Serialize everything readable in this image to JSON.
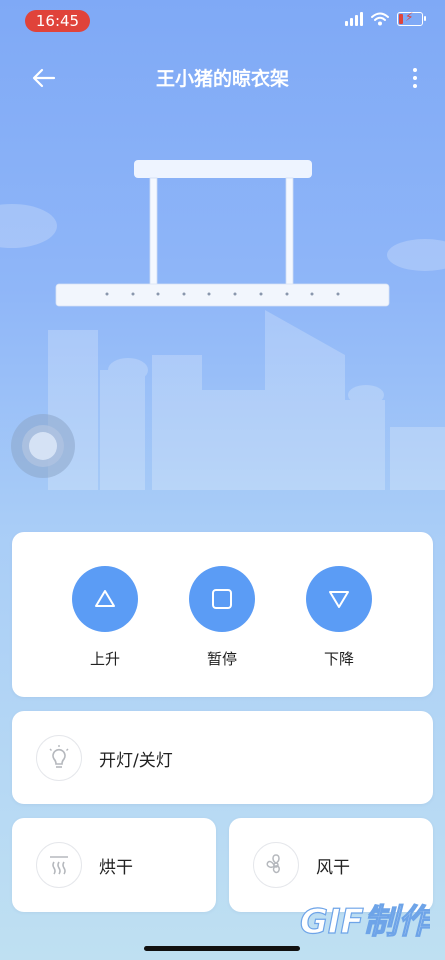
{
  "status_bar": {
    "time": "16:45"
  },
  "header": {
    "title": "王小猪的晾衣架"
  },
  "controls": [
    {
      "id": "up",
      "label": "上升",
      "icon": "triangle-up-icon"
    },
    {
      "id": "pause",
      "label": "暂停",
      "icon": "square-stop-icon"
    },
    {
      "id": "down",
      "label": "下降",
      "icon": "triangle-down-icon"
    }
  ],
  "light": {
    "label": "开灯/关灯",
    "icon": "lightbulb-icon"
  },
  "dry": {
    "label": "烘干",
    "icon": "heat-waves-icon"
  },
  "fan": {
    "label": "风干",
    "icon": "fan-icon"
  },
  "watermark": {
    "text": "GIF制作"
  },
  "colors": {
    "accent": "#5b9cf5",
    "status_pill": "#e0433a"
  }
}
